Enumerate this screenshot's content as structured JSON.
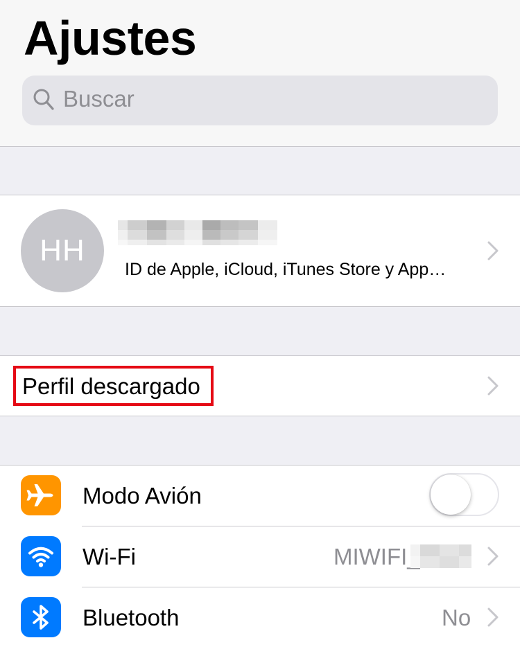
{
  "header": {
    "title": "Ajustes",
    "search": {
      "placeholder": "Buscar",
      "icon": "search-icon"
    }
  },
  "profile": {
    "initials": "HH",
    "name_redacted": true,
    "subtitle": "ID de Apple, iCloud, iTunes Store y App…"
  },
  "downloaded_profile": {
    "label": "Perfil descargado",
    "highlight_color": "#e50914"
  },
  "settings": [
    {
      "key": "airplane",
      "label": "Modo Avión",
      "icon": "airplane-icon",
      "icon_color": "#ff9500",
      "control": "toggle",
      "toggle_on": false
    },
    {
      "key": "wifi",
      "label": "Wi-Fi",
      "icon": "wifi-icon",
      "icon_color": "#007aff",
      "value": "MIWIFI_",
      "value_partially_redacted": true
    },
    {
      "key": "bluetooth",
      "label": "Bluetooth",
      "icon": "bluetooth-icon",
      "icon_color": "#007aff",
      "value": "No"
    }
  ],
  "colors": {
    "background": "#efeff4",
    "secondary_text": "#8e8e93",
    "separator": "#c8c7cc",
    "chevron": "#c7c7cc"
  }
}
